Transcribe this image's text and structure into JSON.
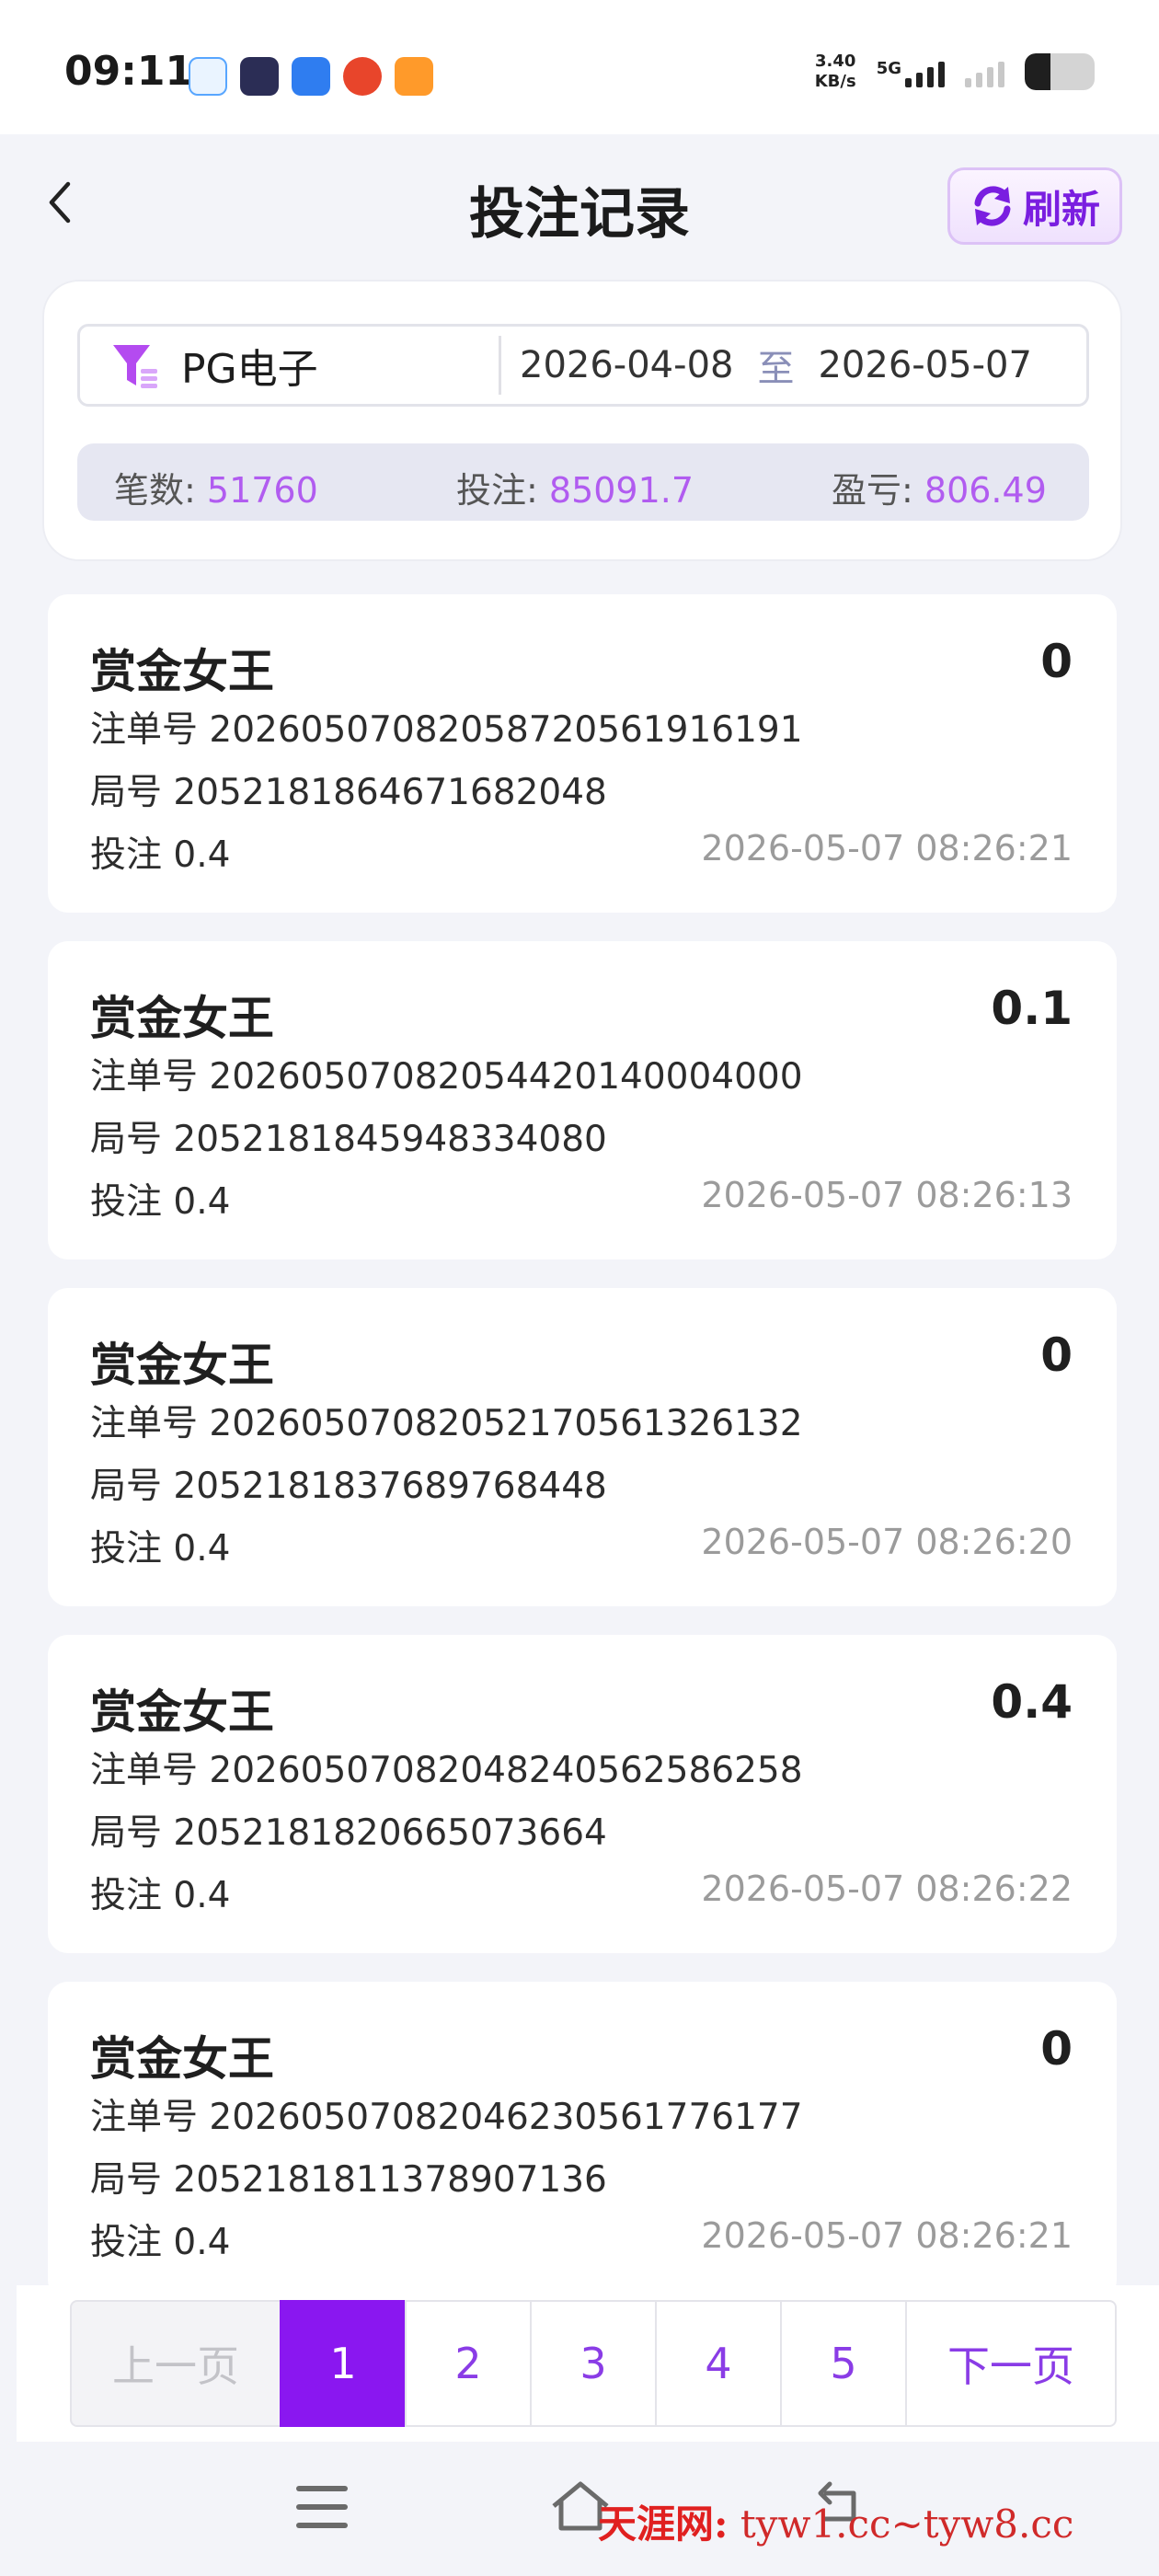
{
  "status_bar": {
    "time": "09:11",
    "net_speed_value": "3.40",
    "net_speed_unit": "KB/s",
    "network": "5G"
  },
  "header": {
    "title": "投注记录",
    "refresh_label": "刷新"
  },
  "filter": {
    "game": "PG电子",
    "date_from": "2026-04-08",
    "date_separator": "至",
    "date_to": "2026-05-07"
  },
  "summary": {
    "count_label": "笔数:",
    "count_value": "51760",
    "bet_label": "投注:",
    "bet_value": "85091.7",
    "profit_label": "盈亏:",
    "profit_value": "806.49"
  },
  "records": [
    {
      "game": "赏金女王",
      "amount": "0",
      "order": "注单号 20260507082058720561916191",
      "round": "局号 2052181864671682048",
      "bet": "投注 0.4",
      "time": "2026-05-07 08:26:21"
    },
    {
      "game": "赏金女王",
      "amount": "0.1",
      "order": "注单号 20260507082054420140004000",
      "round": "局号 2052181845948334080",
      "bet": "投注 0.4",
      "time": "2026-05-07 08:26:13"
    },
    {
      "game": "赏金女王",
      "amount": "0",
      "order": "注单号 20260507082052170561326132",
      "round": "局号 2052181837689768448",
      "bet": "投注 0.4",
      "time": "2026-05-07 08:26:20"
    },
    {
      "game": "赏金女王",
      "amount": "0.4",
      "order": "注单号 20260507082048240562586258",
      "round": "局号 2052181820665073664",
      "bet": "投注 0.4",
      "time": "2026-05-07 08:26:22"
    },
    {
      "game": "赏金女王",
      "amount": "0",
      "order": "注单号 20260507082046230561776177",
      "round": "局号 2052181811378907136",
      "bet": "投注 0.4",
      "time": "2026-05-07 08:26:21"
    }
  ],
  "pagination": {
    "prev": "上一页",
    "pages": [
      "1",
      "2",
      "3",
      "4",
      "5"
    ],
    "current": "1",
    "next": "下一页"
  },
  "watermark": {
    "site": "天涯网",
    "colon": ":",
    "urls": "tyw1.cc~tyw8.cc"
  },
  "colors": {
    "accent": "#8a17f0",
    "summary_value": "#b15cf0"
  }
}
